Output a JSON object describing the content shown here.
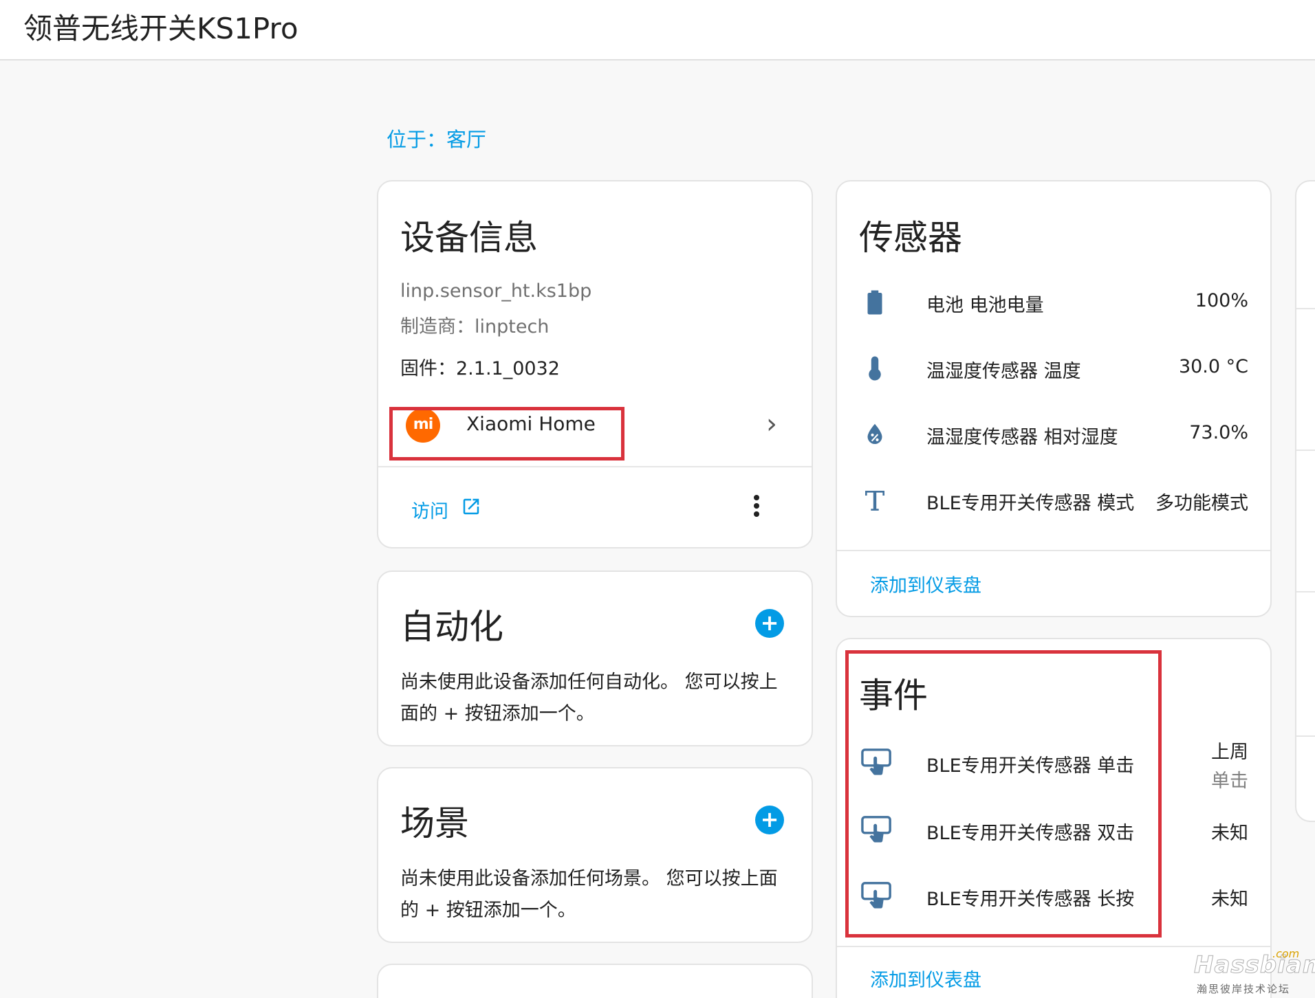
{
  "header": {
    "title": "领普无线开关KS1Pro"
  },
  "breadcrumb": {
    "area": "位于：客厅"
  },
  "device_info": {
    "title": "设备信息",
    "model": "linp.sensor_ht.ks1bp",
    "manufacturer": "制造商：linptech",
    "firmware": "固件：2.1.1_0032",
    "integration": {
      "logo_text": "mi",
      "name": "Xiaomi Home",
      "brand_color": "#ff6900"
    },
    "visit_label": "访问"
  },
  "automation": {
    "title": "自动化",
    "description": "尚未使用此设备添加任何自动化。 您可以按上面的 + 按钮添加一个。"
  },
  "scene": {
    "title": "场景",
    "description": "尚未使用此设备添加任何场景。 您可以按上面的 + 按钮添加一个。"
  },
  "sensors": {
    "title": "传感器",
    "items": [
      {
        "icon": "battery-icon",
        "label": "电池 电池电量",
        "value": "100%"
      },
      {
        "icon": "thermometer-icon",
        "label": "温湿度传感器 温度",
        "value": "30.0 °C"
      },
      {
        "icon": "water-percent-icon",
        "label": "温湿度传感器 相对湿度",
        "value": "73.0%"
      },
      {
        "icon": "text-icon",
        "label": "BLE专用开关传感器 模式",
        "value": "多功能模式"
      }
    ],
    "add_to_dashboard": "添加到仪表盘"
  },
  "events": {
    "title": "事件",
    "items": [
      {
        "icon": "gesture-tap-button-icon",
        "label": "BLE专用开关传感器 单击",
        "value": "上周",
        "sub": "单击"
      },
      {
        "icon": "gesture-tap-button-icon",
        "label": "BLE专用开关传感器 双击",
        "value": "未知"
      },
      {
        "icon": "gesture-tap-button-icon",
        "label": "BLE专用开关传感器 长按",
        "value": "未知"
      }
    ],
    "add_to_dashboard": "添加到仪表盘"
  },
  "colors": {
    "accent": "#039be5",
    "icon": "#44739e",
    "highlight": "#d9323c"
  },
  "watermark": {
    "main": "Hassbian",
    "com": ".com",
    "sub": "瀚思彼岸技术论坛"
  }
}
